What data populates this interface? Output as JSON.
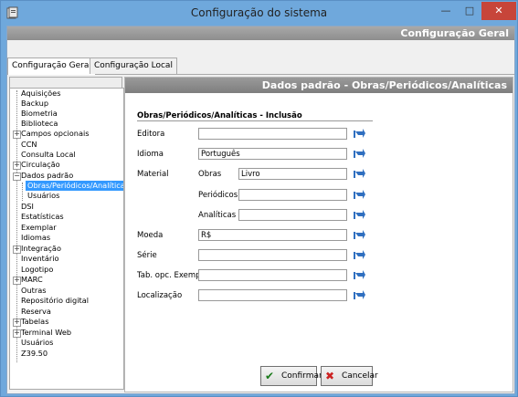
{
  "window": {
    "title": "Configuração do sistema"
  },
  "header": {
    "title": "Configuração Geral"
  },
  "tabs": [
    {
      "label": "Configuração Geral"
    },
    {
      "label": "Configuração Local"
    }
  ],
  "tree": {
    "items": [
      {
        "label": "Aquisições"
      },
      {
        "label": "Backup"
      },
      {
        "label": "Biometria"
      },
      {
        "label": "Biblioteca"
      },
      {
        "label": "Campos opcionais"
      },
      {
        "label": "CCN"
      },
      {
        "label": "Consulta Local"
      },
      {
        "label": "Circulação"
      },
      {
        "label": "Dados padrão"
      },
      {
        "label": "Obras/Periódicos/Analíticas"
      },
      {
        "label": "Usuários"
      },
      {
        "label": "DSI"
      },
      {
        "label": "Estatísticas"
      },
      {
        "label": "Exemplar"
      },
      {
        "label": "Idiomas"
      },
      {
        "label": "Integração"
      },
      {
        "label": "Inventário"
      },
      {
        "label": "Logotipo"
      },
      {
        "label": "MARC"
      },
      {
        "label": "Outras"
      },
      {
        "label": "Repositório digital"
      },
      {
        "label": "Reserva"
      },
      {
        "label": "Tabelas"
      },
      {
        "label": "Terminal Web"
      },
      {
        "label": "Usuários"
      },
      {
        "label": "Z39.50"
      }
    ]
  },
  "panel": {
    "title": "Dados padrão - Obras/Periódicos/Analíticas",
    "section": "Obras/Periódicos/Analíticas - Inclusão",
    "fields": {
      "editora": {
        "label": "Editora",
        "value": ""
      },
      "idioma": {
        "label": "Idioma",
        "value": "Português"
      },
      "material": {
        "label": "Material"
      },
      "obras": {
        "label": "Obras",
        "value": "Livro"
      },
      "periodicos": {
        "label": "Periódicos",
        "value": ""
      },
      "analiticas": {
        "label": "Analíticas",
        "value": ""
      },
      "moeda": {
        "label": "Moeda",
        "value": "R$"
      },
      "serie": {
        "label": "Série",
        "value": ""
      },
      "tab_opc": {
        "label": "Tab. opc. Exemp",
        "value": ""
      },
      "localizacao": {
        "label": "Localização",
        "value": ""
      }
    },
    "buttons": {
      "confirm": "Confirmar",
      "cancel": "Cancelar"
    }
  },
  "colors": {
    "titlebar": "#6fa8dc",
    "close": "#c7453a",
    "selection": "#3399ff",
    "link_icon": "#2f6fc0",
    "confirm_check": "#1a7a1a",
    "cancel_x": "#cc2222"
  }
}
